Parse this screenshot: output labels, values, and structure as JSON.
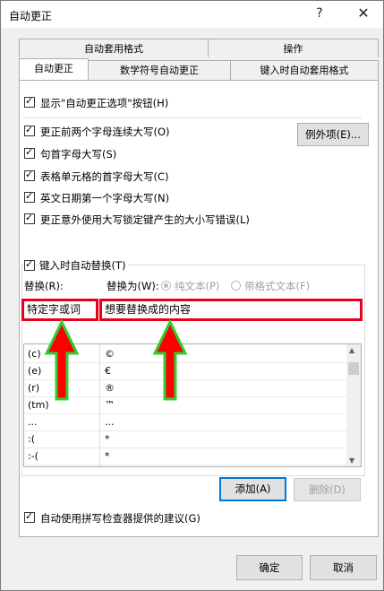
{
  "window": {
    "title": "自动更正",
    "help_glyph": "?",
    "close_glyph": "✕"
  },
  "tabs_back": [
    "自动套用格式",
    "操作"
  ],
  "tabs_front": [
    "自动更正",
    "数学符号自动更正",
    "键入时自动套用格式"
  ],
  "options": {
    "show_button": "显示\"自动更正选项\"按钮(H)",
    "two_initial_caps": "更正前两个字母连续大写(O)",
    "first_letter_sentence": "句首字母大写(S)",
    "first_letter_cells": "表格单元格的首字母大写(C)",
    "day_names": "英文日期第一个字母大写(N)",
    "caps_lock": "更正意外使用大写锁定键产生的大小写错误(L)",
    "exceptions_button": "例外项(E)..."
  },
  "replace_section": {
    "checkbox": "键入时自动替换(T)",
    "replace_label": "替换(R):",
    "with_label": "替换为(W):",
    "plain_text": "纯文本(P)",
    "formatted_text": "带格式文本(F)",
    "replace_value": "特定字或词",
    "with_value": "想要替换成的内容"
  },
  "entries": [
    {
      "from": "(c)",
      "to": "©"
    },
    {
      "from": "(e)",
      "to": "€"
    },
    {
      "from": "(r)",
      "to": "®"
    },
    {
      "from": "(tm)",
      "to": "™"
    },
    {
      "from": "...",
      "to": "..."
    },
    {
      "from": ":(",
      "to": "*"
    },
    {
      "from": ":-(",
      "to": "*"
    }
  ],
  "buttons": {
    "add": "添加(A)",
    "delete": "删除(D)",
    "ok": "确定",
    "cancel": "取消"
  },
  "spellcheck": "自动使用拼写检查器提供的建议(G)",
  "colors": {
    "annotation_red": "#e6001a",
    "arrow_fill": "#ff0000",
    "arrow_outline": "#33cc33"
  }
}
